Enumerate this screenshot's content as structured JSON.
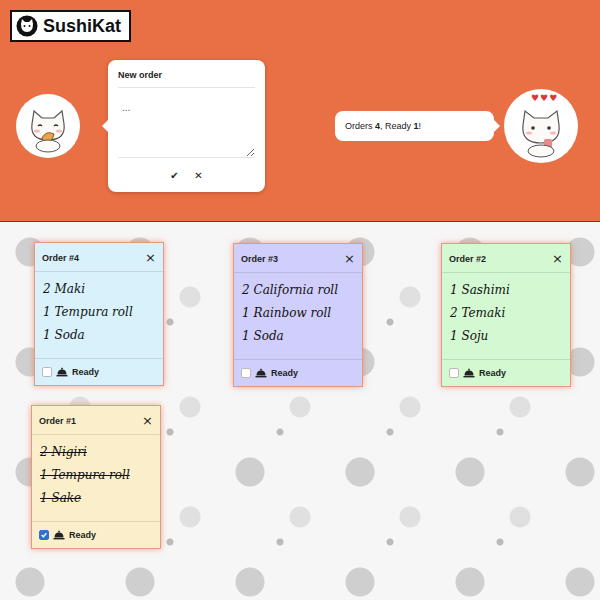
{
  "logo": {
    "text": "SushiKat"
  },
  "new_order": {
    "title": "New order",
    "placeholder": "...",
    "buttons": [
      "✔",
      "✕"
    ]
  },
  "status": {
    "parts": [
      {
        "text": "Orders ",
        "bold": false
      },
      {
        "text": "4",
        "bold": true
      },
      {
        "text": ", Ready ",
        "bold": false
      },
      {
        "text": "1",
        "bold": true
      },
      {
        "text": "!",
        "bold": false
      }
    ]
  },
  "hearts": "♥♥♥",
  "orders": [
    {
      "title": "Order #4",
      "close": "×",
      "color": "#d8f1fb",
      "items": [
        "2 Maki",
        "1 Tempura roll",
        "1 Soda"
      ],
      "ready": false,
      "ready_label": "Ready"
    },
    {
      "title": "Order #3",
      "close": "×",
      "color": "#d0cefb",
      "items": [
        "2 California roll",
        "1 Rainbow roll",
        "1 Soda"
      ],
      "ready": false,
      "ready_label": "Ready"
    },
    {
      "title": "Order #2",
      "close": "×",
      "color": "#d4f8d1",
      "items": [
        "1 Sashimi",
        "2 Temaki",
        "1 Soju"
      ],
      "ready": false,
      "ready_label": "Ready"
    },
    {
      "title": "Order #1",
      "close": "×",
      "color": "#fbefcb",
      "items": [
        "2 Nigiri",
        "1 Tempura roll",
        "1 Sake"
      ],
      "ready": true,
      "ready_label": "Ready"
    }
  ]
}
